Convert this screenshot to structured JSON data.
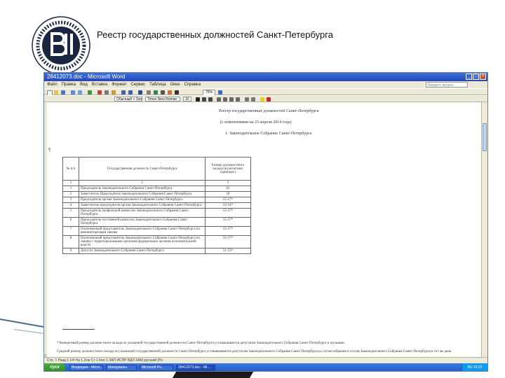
{
  "slide": {
    "title": "Реестр государственных должностей Санкт-Петербурга"
  },
  "window": {
    "title": "28412073.doc - Microsoft Word",
    "menu": [
      "Файл",
      "Правка",
      "Вид",
      "Вставка",
      "Формат",
      "Сервис",
      "Таблица",
      "Окно",
      "Справка"
    ],
    "help_placeholder": "Введите вопрос",
    "zoom": "75%",
    "style_value": "Обычный + Заче",
    "font_value": "Times New Roman",
    "size_value": "10"
  },
  "document": {
    "heading": "Реестр государственных должностей Санкт-Петербурга",
    "subheading": "(с изменениями на 23 апреля 2014 года)",
    "section": "1. Законодательное Собрание Санкт-Петербурга",
    "table": {
      "headers": [
        "№ п/п",
        "Государственная должность Санкт-Петербурга",
        "Размер должностного оклада (в расчетных единицах)"
      ],
      "number_row": [
        "1",
        "2",
        "3"
      ],
      "rows": [
        [
          "1",
          "Председатель Законодательного Собрания Санкт-Петербурга",
          "62"
        ],
        [
          "2",
          "Заместитель Председателя Законодательного Собрания Санкт-Петербурга",
          "58"
        ],
        [
          "3",
          "Председатель органа Законодательного Собрания Санкт-Петербурга",
          "55-57*"
        ],
        [
          "4",
          "Заместитель председателя органа Законодательного Собрания Санкт-Петербурга",
          "52-54*"
        ],
        [
          "5",
          "Председатель профильной комиссии Законодательного Собрания Санкт-Петербурга",
          "55-57*"
        ],
        [
          "6",
          "Председатель постоянной комиссии Законодательного Собрания Санкт-Петербурга",
          "55-57*"
        ],
        [
          "7",
          "Полномочный представитель Законодательного Собрания Санкт-Петербурга по внешнеторговым связям",
          "55-57*"
        ],
        [
          "8",
          "Полномочный представитель Законодательного Собрания Санкт-Петербурга по связям с территориальными органами федеральных органов исполнительной власти",
          "55-57*"
        ],
        [
          "9",
          "Депутат Законодательного Собрания Санкт-Петербурга",
          "51-53*"
        ]
      ]
    },
    "footnote_1": "* Конкретный размер должностного оклада по указанной государственной должности Санкт-Петербурга устанавливается депутатам Законодательного Собрания Санкт-Петербурга и органами.",
    "footnote_2": "Средний размер должностного оклада по указанной государственной должности Санкт-Петербурга устанавливается депутатам Законодательного Собрания Санкт-Петербурга в случае избрания в состав Законодательного Собрания Санкт-Петербурга в тот же день."
  },
  "statusbar": {
    "text": "Стр. 1   Разд 1   1/4   На 1,2см   Ст 1   Кол 1   ЗАП   ИСПР   ВДЛ   ЗАМ   русский (Ро"
  },
  "taskbar": {
    "start": "пуск",
    "tasks": [
      "Входящие - Micro...",
      "Материалы",
      "Microsoft Po...",
      "28412073.doc - Mi..."
    ],
    "clock": "RU 16:22"
  },
  "colors": {
    "titlebar": "#1d49b8",
    "taskbar": "#2259c9",
    "start": "#2f8a24",
    "chrome": "#ece9d8"
  }
}
